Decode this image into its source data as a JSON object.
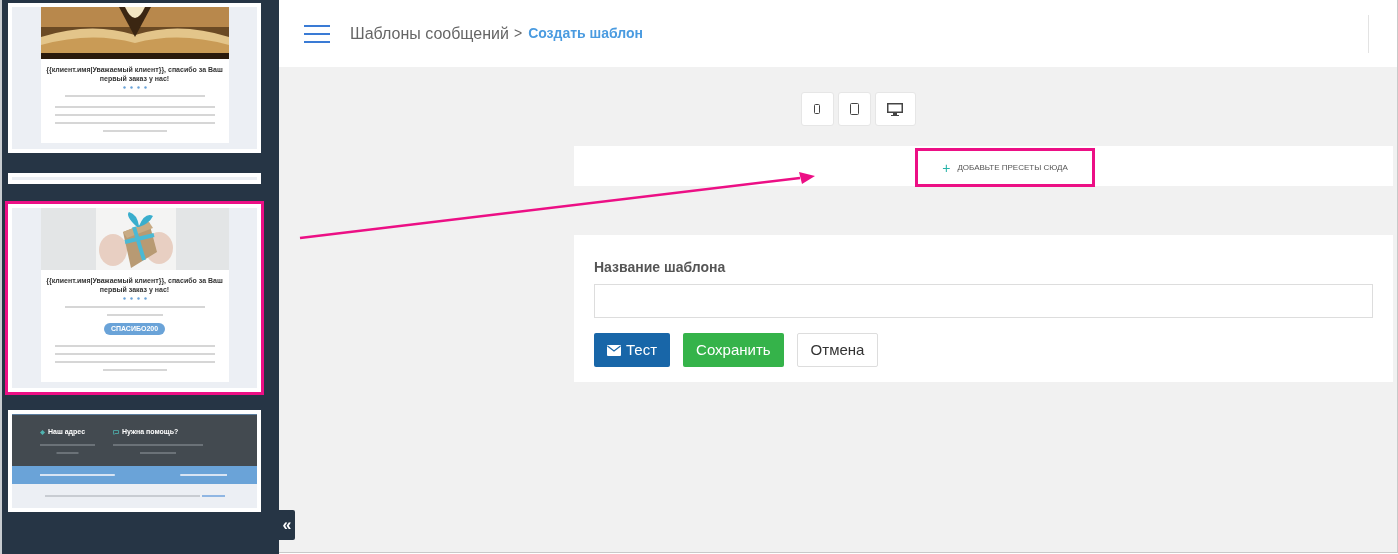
{
  "templates": [
    {
      "kind": "message",
      "selected": false,
      "title": "{{клиент.имя|Уважаемый клиент}}, спасибо за Ваш первый заказ у нас!"
    },
    {
      "kind": "blank",
      "selected": false
    },
    {
      "kind": "message",
      "selected": true,
      "title": "{{клиент.имя|Уважаемый клиент}}, спасибо за Ваш первый заказ у нас!",
      "button": "СПАСИБО200"
    },
    {
      "kind": "footer",
      "selected": false,
      "columns": [
        {
          "heading": "Наш адрес"
        },
        {
          "heading": "Нужна помощь?"
        }
      ]
    }
  ],
  "collapse_button": "«",
  "breadcrumb": {
    "parent": "Шаблоны сообщений",
    "separator": ">",
    "current": "Создать шаблон"
  },
  "device_buttons": [
    {
      "kind": "phone"
    },
    {
      "kind": "tablet"
    },
    {
      "kind": "desktop"
    }
  ],
  "presets_dropzone": {
    "icon": "+",
    "label": "ДОБАВЬТЕ ПРЕСЕТЫ СЮДА"
  },
  "form": {
    "label": "Название шаблона",
    "buttons": [
      {
        "kind": "primary",
        "label": "Тест"
      },
      {
        "kind": "success",
        "label": "Сохранить"
      },
      {
        "kind": "default",
        "label": "Отмена"
      }
    ]
  }
}
